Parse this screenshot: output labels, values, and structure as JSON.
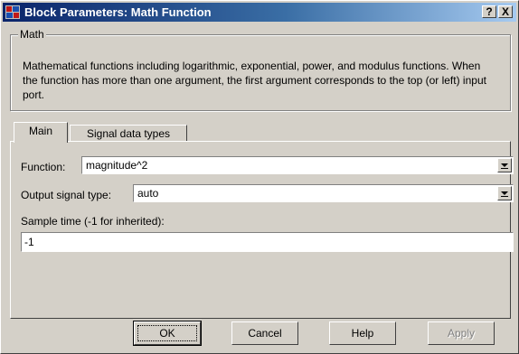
{
  "window": {
    "title": "Block Parameters: Math Function",
    "help_button": "?",
    "close_button": "X"
  },
  "group": {
    "legend": "Math",
    "description": "Mathematical functions including logarithmic, exponential, power, and modulus functions.  When the function has more than one argument, the first argument corresponds to the top (or left) input port."
  },
  "tabs": [
    {
      "label": "Main",
      "active": true
    },
    {
      "label": "Signal data types",
      "active": false
    }
  ],
  "main": {
    "function_label": "Function:",
    "function_value": "magnitude^2",
    "output_type_label": "Output signal type:",
    "output_type_value": "auto",
    "sample_time_label": "Sample time (-1 for inherited):",
    "sample_time_value": "-1"
  },
  "buttons": {
    "ok": "OK",
    "cancel": "Cancel",
    "help": "Help",
    "apply": "Apply"
  }
}
